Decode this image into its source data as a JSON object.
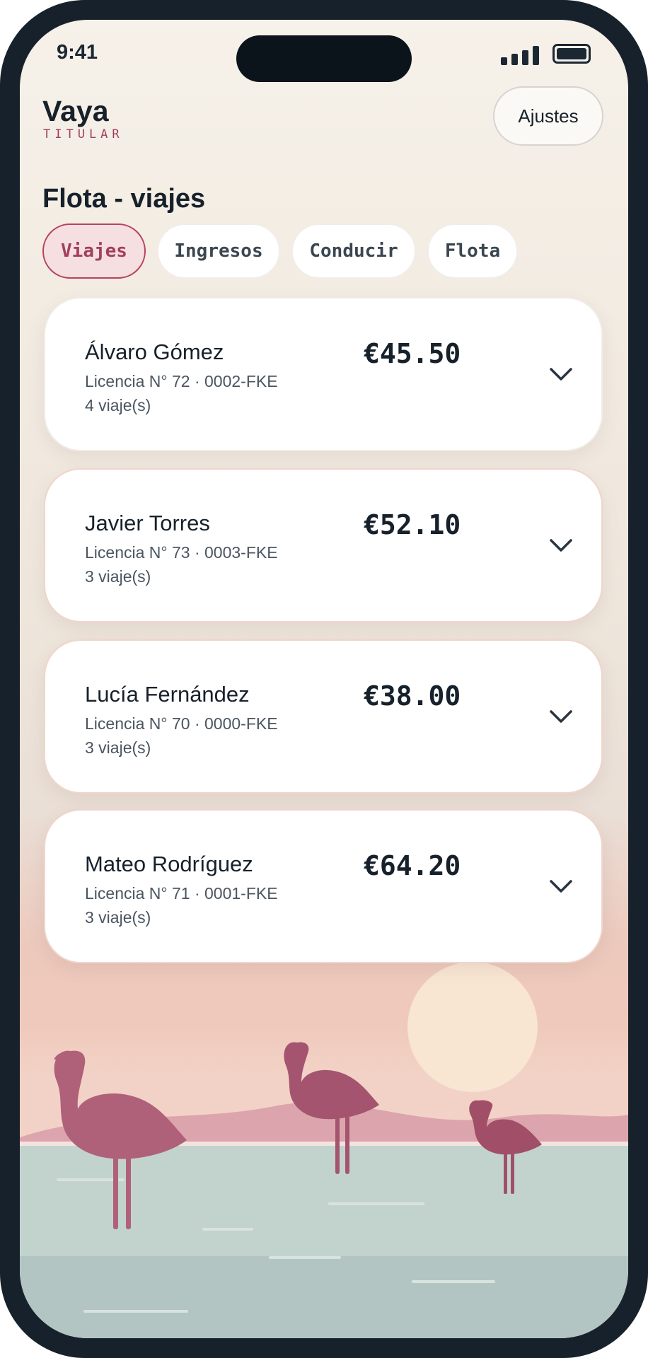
{
  "status_bar": {
    "time": "9:41"
  },
  "header": {
    "brand": "Vaya",
    "role": "TITULAR",
    "settings_label": "Ajustes"
  },
  "page": {
    "title": "Flota - viajes"
  },
  "tabs": [
    {
      "label": "Viajes",
      "active": true
    },
    {
      "label": "Ingresos",
      "active": false
    },
    {
      "label": "Conducir",
      "active": false
    },
    {
      "label": "Flota",
      "active": false
    }
  ],
  "drivers": [
    {
      "name": "Álvaro Gómez",
      "license": "Licencia N° 72 · 0002-FKE",
      "trips": "4 viaje(s)",
      "amount": "€45.50"
    },
    {
      "name": "Javier Torres",
      "license": "Licencia N° 73 · 0003-FKE",
      "trips": "3 viaje(s)",
      "amount": "€52.10"
    },
    {
      "name": "Lucía Fernández",
      "license": "Licencia N° 70 · 0000-FKE",
      "trips": "3 viaje(s)",
      "amount": "€38.00"
    },
    {
      "name": "Mateo Rodríguez",
      "license": "Licencia N° 71 · 0001-FKE",
      "trips": "3 viaje(s)",
      "amount": "€64.20"
    }
  ],
  "icons": {
    "expand": "chevron-down-icon"
  },
  "colors": {
    "accent": "#a33e5d",
    "text": "#17212b",
    "frame": "#17212b",
    "active_tab_bg": "#f5dfe1",
    "flamingo": "#b0617a",
    "water": "#c2d3ce"
  }
}
